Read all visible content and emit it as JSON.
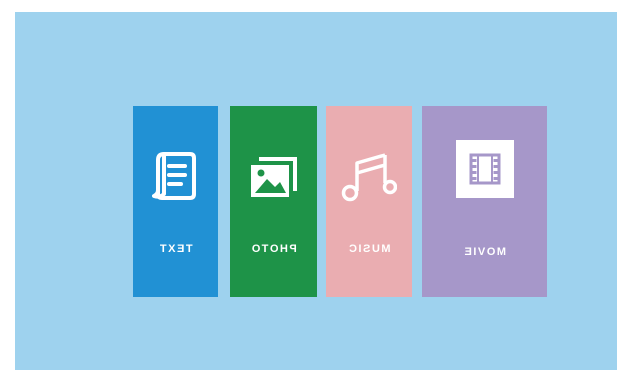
{
  "menu": {
    "items": [
      {
        "label": "TEXT",
        "icon": "document-icon",
        "color": "#2191d4"
      },
      {
        "label": "PHOTO",
        "icon": "photo-icon",
        "color": "#1e9348"
      },
      {
        "label": "MUSIC",
        "icon": "music-note-icon",
        "color": "#eaadb1"
      },
      {
        "label": "MOVIE",
        "icon": "film-icon",
        "color": "#a697c9"
      }
    ],
    "background": "#9ed2ee",
    "label_orientation": "mirrored"
  }
}
